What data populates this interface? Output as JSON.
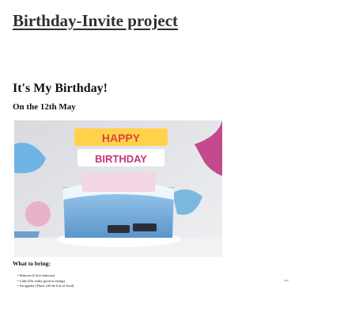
{
  "page": {
    "title": "Birthday-Invite project",
    "heading": "It's My Birthday!",
    "subheading": "On the 12th May"
  },
  "hero_image": {
    "alt": "cake",
    "banner_lines": [
      "HAPPY",
      "BIRTHDAY"
    ]
  },
  "bring": {
    "label": "What to bring:",
    "items": [
      {
        "name": "Baloons",
        "note": "(I love baloons)"
      },
      {
        "name": "Cake",
        "note": "(I'm really good at eating)"
      },
      {
        "name": "An apptite",
        "note": "(There will be lots of food)"
      }
    ]
  },
  "colors": {
    "title": "#2f2f2f",
    "image_backdrop": "#e3e4e8",
    "cake_frosting": "#7fb6e3",
    "banner_red": "#d8453c"
  }
}
